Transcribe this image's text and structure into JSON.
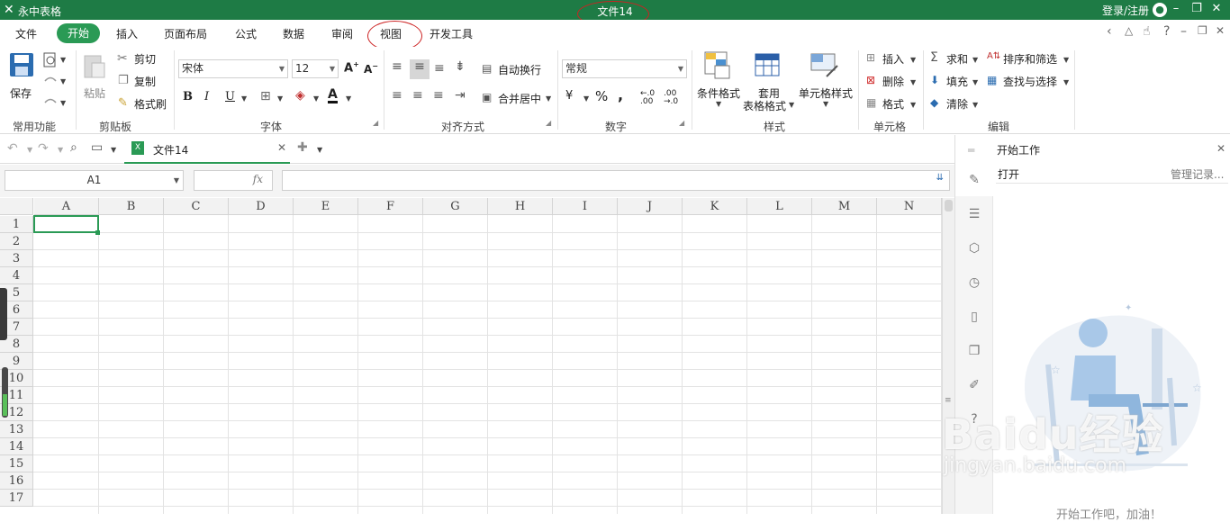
{
  "titlebar": {
    "app_name": "永中表格",
    "doc_title": "文件14",
    "login": "登录/注册",
    "min": "–",
    "restore": "❐",
    "close": "✕"
  },
  "menu": {
    "items": [
      "文件",
      "开始",
      "插入",
      "页面布局",
      "公式",
      "数据",
      "审阅",
      "视图",
      "开发工具"
    ],
    "active": "开始"
  },
  "ribbon": {
    "save": "保存",
    "paste": "粘贴",
    "cut": "剪切",
    "copy": "复制",
    "format_painter": "格式刷",
    "font_name": "宋体",
    "font_size": "12",
    "bold": "B",
    "italic": "I",
    "underline": "U",
    "wrap": "自动换行",
    "merge": "合并居中",
    "number_format": "常规",
    "currency": "¥",
    "percent": "%",
    "comma": ",",
    "cond_format": "条件格式",
    "table_format_1": "套用",
    "table_format_2": "表格格式",
    "cell_style": "单元格样式",
    "insert": "插入",
    "delete": "删除",
    "format": "格式",
    "sum": "求和",
    "fill": "填充",
    "clear": "清除",
    "sort_filter": "排序和筛选",
    "find_select": "查找与选择",
    "groups": {
      "common": "常用功能",
      "clipboard": "剪贴板",
      "font": "字体",
      "align": "对齐方式",
      "number": "数字",
      "styles": "样式",
      "cells": "单元格",
      "edit": "编辑"
    }
  },
  "tabs": {
    "doc_tab": "文件14"
  },
  "formula_bar": {
    "name_box": "A1",
    "fx": "fx",
    "value": ""
  },
  "grid": {
    "columns": [
      "A",
      "B",
      "C",
      "D",
      "E",
      "F",
      "G",
      "H",
      "I",
      "J",
      "K",
      "L",
      "M",
      "N"
    ],
    "rows": [
      "1",
      "2",
      "3",
      "4",
      "5",
      "6",
      "7",
      "8",
      "9",
      "10",
      "11",
      "12",
      "13",
      "14",
      "15",
      "16",
      "17"
    ]
  },
  "side_pane": {
    "title": "开始工作",
    "open": "打开",
    "manage": "管理记录...",
    "cheer": "开始工作吧，加油！"
  },
  "watermark": {
    "brand": "Baidu经验",
    "url": "jingyan.baidu.com"
  },
  "colors": {
    "title_green": "#1e7b45",
    "accent_green": "#2a9a55",
    "annotation_red": "#cc2222"
  }
}
